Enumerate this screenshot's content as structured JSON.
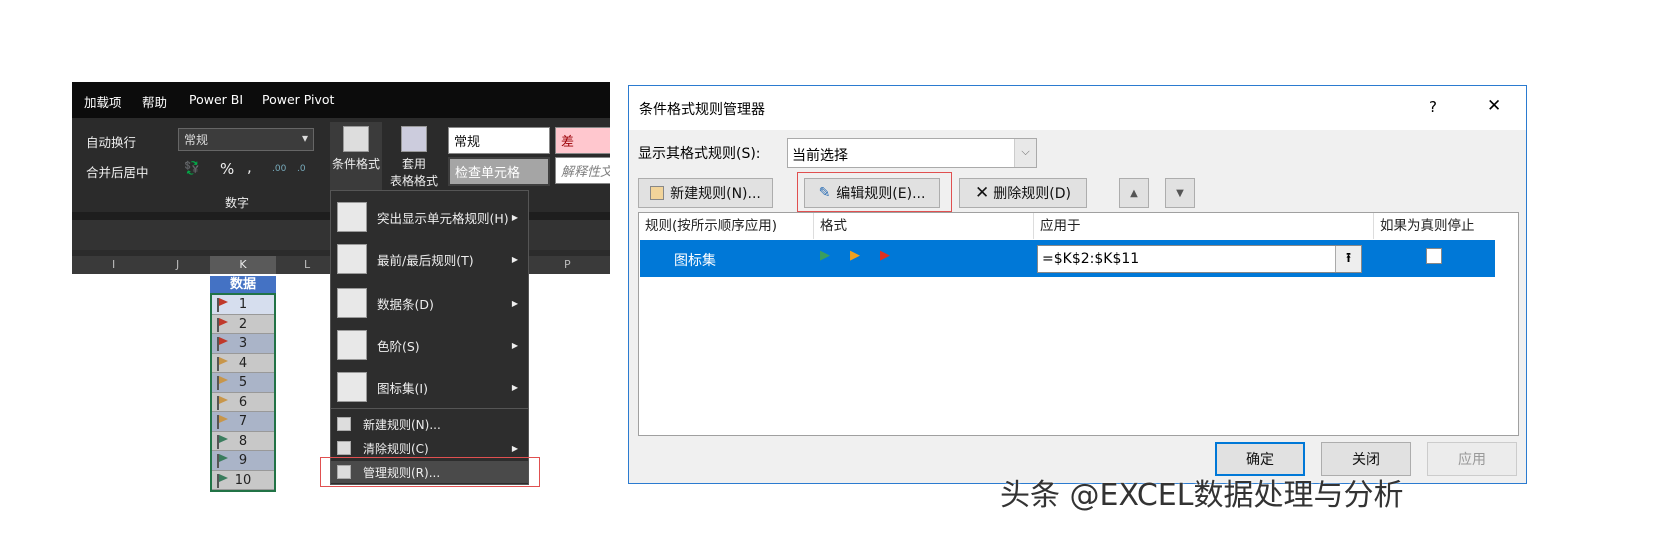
{
  "excel": {
    "tabs": [
      "加载项",
      "帮助",
      "Power BI",
      "Power Pivot"
    ],
    "ribbon": {
      "wrap_text": "自动换行",
      "merge_center": "合并后居中",
      "number_format": "常规",
      "percent": "%",
      "comma": ",",
      "inc_decimal": ".00",
      "dec_decimal": ".0",
      "number_group": "数字",
      "conditional_format": "条件格式",
      "table_format_1": "套用",
      "table_format_2": "表格格式",
      "style_normal": "常规",
      "style_bad": "差",
      "style_check": "检查单元格",
      "style_explain": "解释性文"
    },
    "columns": [
      "I",
      "J",
      "K",
      "L",
      "P"
    ],
    "header_cell": "数据",
    "cells": [
      {
        "value": "1",
        "flag": "#c0392b"
      },
      {
        "value": "2",
        "flag": "#c0392b"
      },
      {
        "value": "3",
        "flag": "#c0392b"
      },
      {
        "value": "4",
        "flag": "#c8964a"
      },
      {
        "value": "5",
        "flag": "#c8964a"
      },
      {
        "value": "6",
        "flag": "#c8964a"
      },
      {
        "value": "7",
        "flag": "#c8964a"
      },
      {
        "value": "8",
        "flag": "#3a7d5e"
      },
      {
        "value": "9",
        "flag": "#3a7d5e"
      },
      {
        "value": "10",
        "flag": "#3a7d5e"
      }
    ],
    "menu": [
      "突出显示单元格规则(H)",
      "最前/最后规则(T)",
      "数据条(D)",
      "色阶(S)",
      "图标集(I)",
      "新建规则(N)...",
      "清除规则(C)",
      "管理规则(R)..."
    ]
  },
  "dialog": {
    "title": "条件格式规则管理器",
    "help": "?",
    "close": "✕",
    "show_rules_label": "显示其格式规则(S):",
    "show_rules_value": "当前选择",
    "new_rule": "新建规则(N)...",
    "edit_rule": "编辑规则(E)...",
    "delete_rule": "删除规则(D)",
    "up": "▲",
    "down": "▼",
    "headers": [
      "规则(按所示顺序应用)",
      "格式",
      "应用于",
      "如果为真则停止"
    ],
    "row": {
      "rule": "图标集",
      "applies_to": "=$K$2:$K$11",
      "stop_if_true": false
    },
    "ok": "确定",
    "close_btn": "关闭",
    "apply": "应用"
  },
  "watermark": "头条 @EXCEL数据处理与分析",
  "colors": {
    "accent": "#0078d7",
    "highlight": "#e05050"
  }
}
